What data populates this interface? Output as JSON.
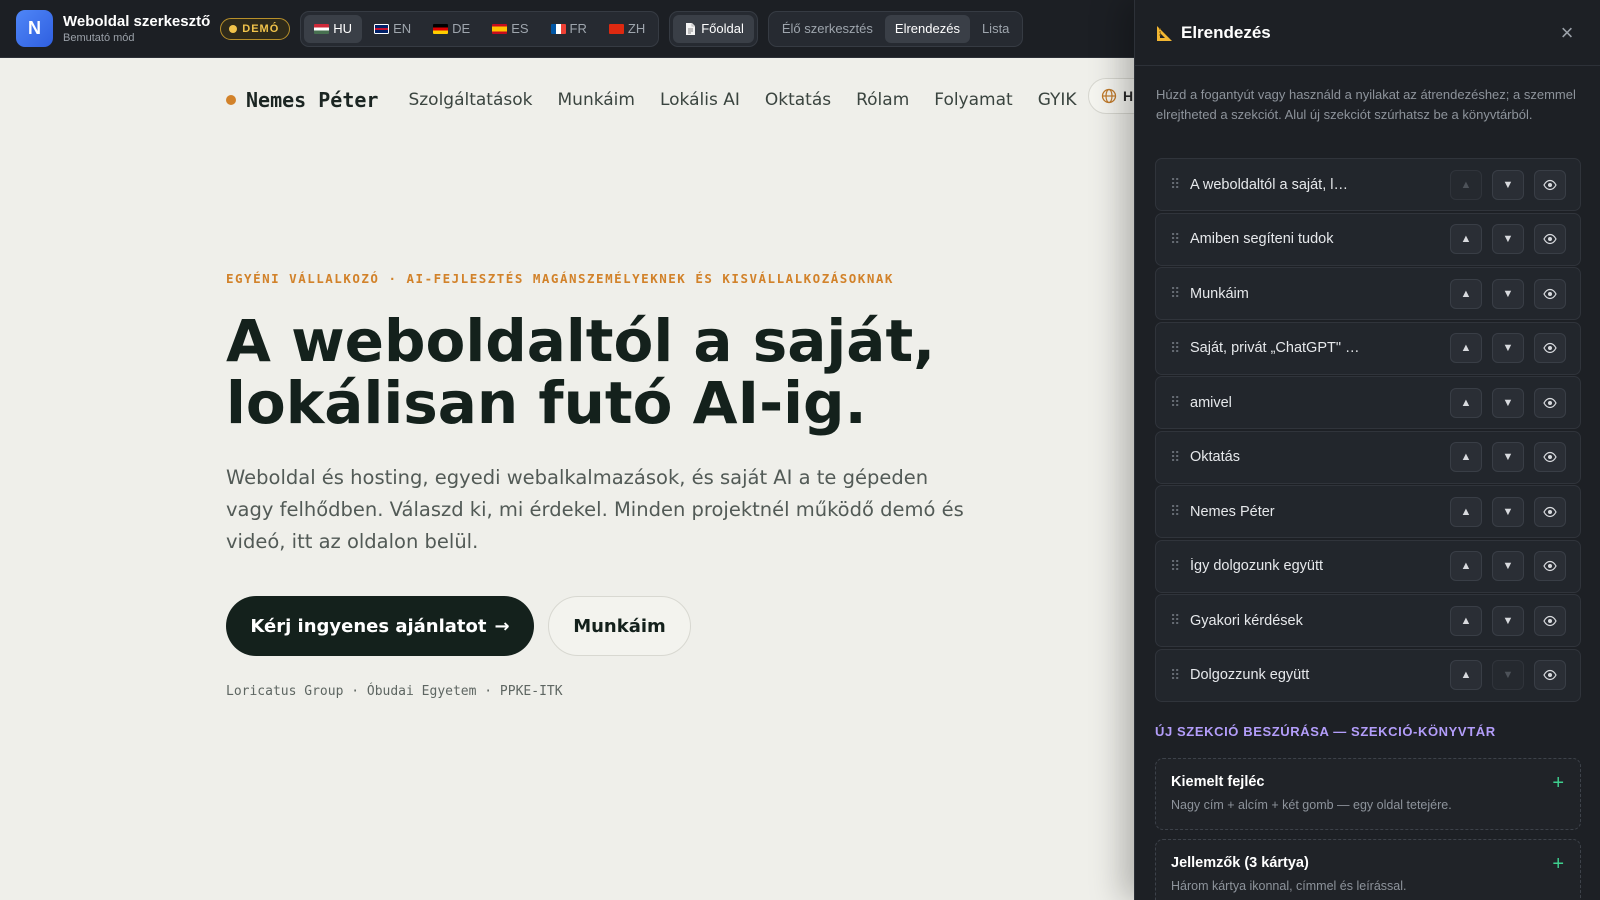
{
  "editor": {
    "logo_letter": "N",
    "title": "Weboldal szerkesztő",
    "subtitle": "Bemutató mód",
    "demo_badge": "DEMÓ",
    "languages": [
      {
        "code": "HU",
        "flag": "flag-hu-icon",
        "active": true
      },
      {
        "code": "EN",
        "flag": "flag-gb-icon",
        "active": false
      },
      {
        "code": "DE",
        "flag": "flag-de-icon",
        "active": false
      },
      {
        "code": "ES",
        "flag": "flag-es-icon",
        "active": false
      },
      {
        "code": "FR",
        "flag": "flag-fr-icon",
        "active": false
      },
      {
        "code": "ZH",
        "flag": "flag-cn-icon",
        "active": false
      }
    ],
    "page_selector": {
      "icon": "page-icon",
      "label": "Főoldal"
    },
    "modes": [
      {
        "label": "Élő szerkesztés",
        "active": false
      },
      {
        "label": "Elrendezés",
        "active": true
      },
      {
        "label": "Lista",
        "active": false
      }
    ]
  },
  "site": {
    "brand": "Nemes Péter",
    "nav": [
      "Szolgáltatások",
      "Munkáim",
      "Lokális AI",
      "Oktatás",
      "Rólam",
      "Folyamat",
      "GYIK"
    ],
    "lang_pill": "H",
    "eyebrow": "EGYÉNI VÁLLALKOZÓ · AI-FEJLESZTÉS MAGÁNSZEMÉLYEKNEK ÉS KISVÁLLALKOZÁSOKNAK",
    "hero_title_line1": "A weboldaltól a saját,",
    "hero_title_line2": "lokálisan futó AI-ig.",
    "hero_description": "Weboldal és hosting, egyedi webalkalmazások, és saját AI a te gépeden vagy felhődben. Válaszd ki, mi érdekel. Minden projektnél működő demó és videó, itt az oldalon belül.",
    "cta_primary": "Kérj ingyenes ajánlatot",
    "cta_primary_arrow": "→",
    "cta_secondary": "Munkáim",
    "affiliations": "Loricatus Group · Óbudai Egyetem · PPKE-ITK"
  },
  "panel": {
    "icon": "triangular-ruler-icon",
    "title": "Elrendezés",
    "close_label": "×",
    "hint": "Húzd a fogantyút vagy használd a nyilakat az átrendezéshez; a szemmel elrejtheted a szekciót. Alul új szekciót szúrhatsz be a könyvtárból.",
    "grip": "⠿",
    "up_symbol": "▲",
    "down_symbol": "▼",
    "sections": [
      {
        "label": "A weboldaltól a saját, l…",
        "up_disabled": true,
        "down_disabled": false
      },
      {
        "label": "Amiben segíteni tudok",
        "up_disabled": false,
        "down_disabled": false
      },
      {
        "label": "Munkáim",
        "up_disabled": false,
        "down_disabled": false
      },
      {
        "label": "Saját, privát „ChatGPT\" …",
        "up_disabled": false,
        "down_disabled": false
      },
      {
        "label": "amivel",
        "up_disabled": false,
        "down_disabled": false
      },
      {
        "label": "Oktatás",
        "up_disabled": false,
        "down_disabled": false
      },
      {
        "label": "Nemes Péter",
        "up_disabled": false,
        "down_disabled": false
      },
      {
        "label": "Így dolgozunk együtt",
        "up_disabled": false,
        "down_disabled": false
      },
      {
        "label": "Gyakori kérdések",
        "up_disabled": false,
        "down_disabled": false
      },
      {
        "label": "Dolgozzunk együtt",
        "up_disabled": false,
        "down_disabled": true
      }
    ],
    "library_title": "ÚJ SZEKCIÓ BESZÚRÁSA — SZEKCIÓ-KÖNYVTÁR",
    "library": [
      {
        "title": "Kiemelt fejléc",
        "description": "Nagy cím + alcím + két gomb — egy oldal tetejére."
      },
      {
        "title": "Jellemzők (3 kártya)",
        "description": "Három kártya ikonnal, címmel és leírással."
      }
    ],
    "plus_symbol": "+"
  },
  "colors": {
    "accent_orange": "#d2822a",
    "dark_text": "#14211c",
    "panel_bg": "#1d2025",
    "library_accent": "#b39dfa",
    "plus_green": "#3ecf8e",
    "demo_yellow": "#f1c34a"
  }
}
